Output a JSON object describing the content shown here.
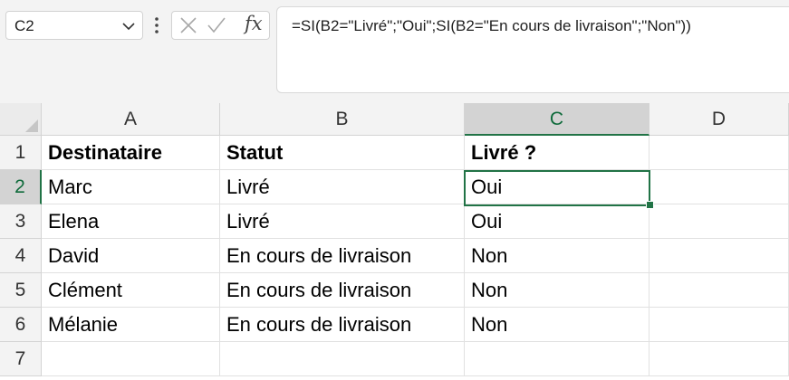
{
  "name_box": {
    "value": "C2",
    "icon": "chevron-down-icon"
  },
  "formula_bar": {
    "cancel_icon": "cross-icon",
    "enter_icon": "checkmark-icon",
    "fx_label": "fx",
    "formula": "=SI(B2=\"Livré\";\"Oui\";SI(B2=\"En cours de livraison\";\"Non\"))"
  },
  "columns": [
    "A",
    "B",
    "C",
    "D"
  ],
  "rows": [
    "1",
    "2",
    "3",
    "4",
    "5",
    "6",
    "7"
  ],
  "cells": {
    "header": [
      "Destinataire",
      "Statut",
      "Livré ?"
    ],
    "r2": [
      "Marc",
      "Livré",
      "Oui"
    ],
    "r3": [
      "Elena",
      "Livré",
      "Oui"
    ],
    "r4": [
      "David",
      "En cours de livraison",
      "Non"
    ],
    "r5": [
      "Clément",
      "En cours de livraison",
      "Non"
    ],
    "r6": [
      "Mélanie",
      "En cours de livraison",
      "Non"
    ]
  },
  "active_cell": "C2",
  "colors": {
    "accent": "#217346"
  }
}
